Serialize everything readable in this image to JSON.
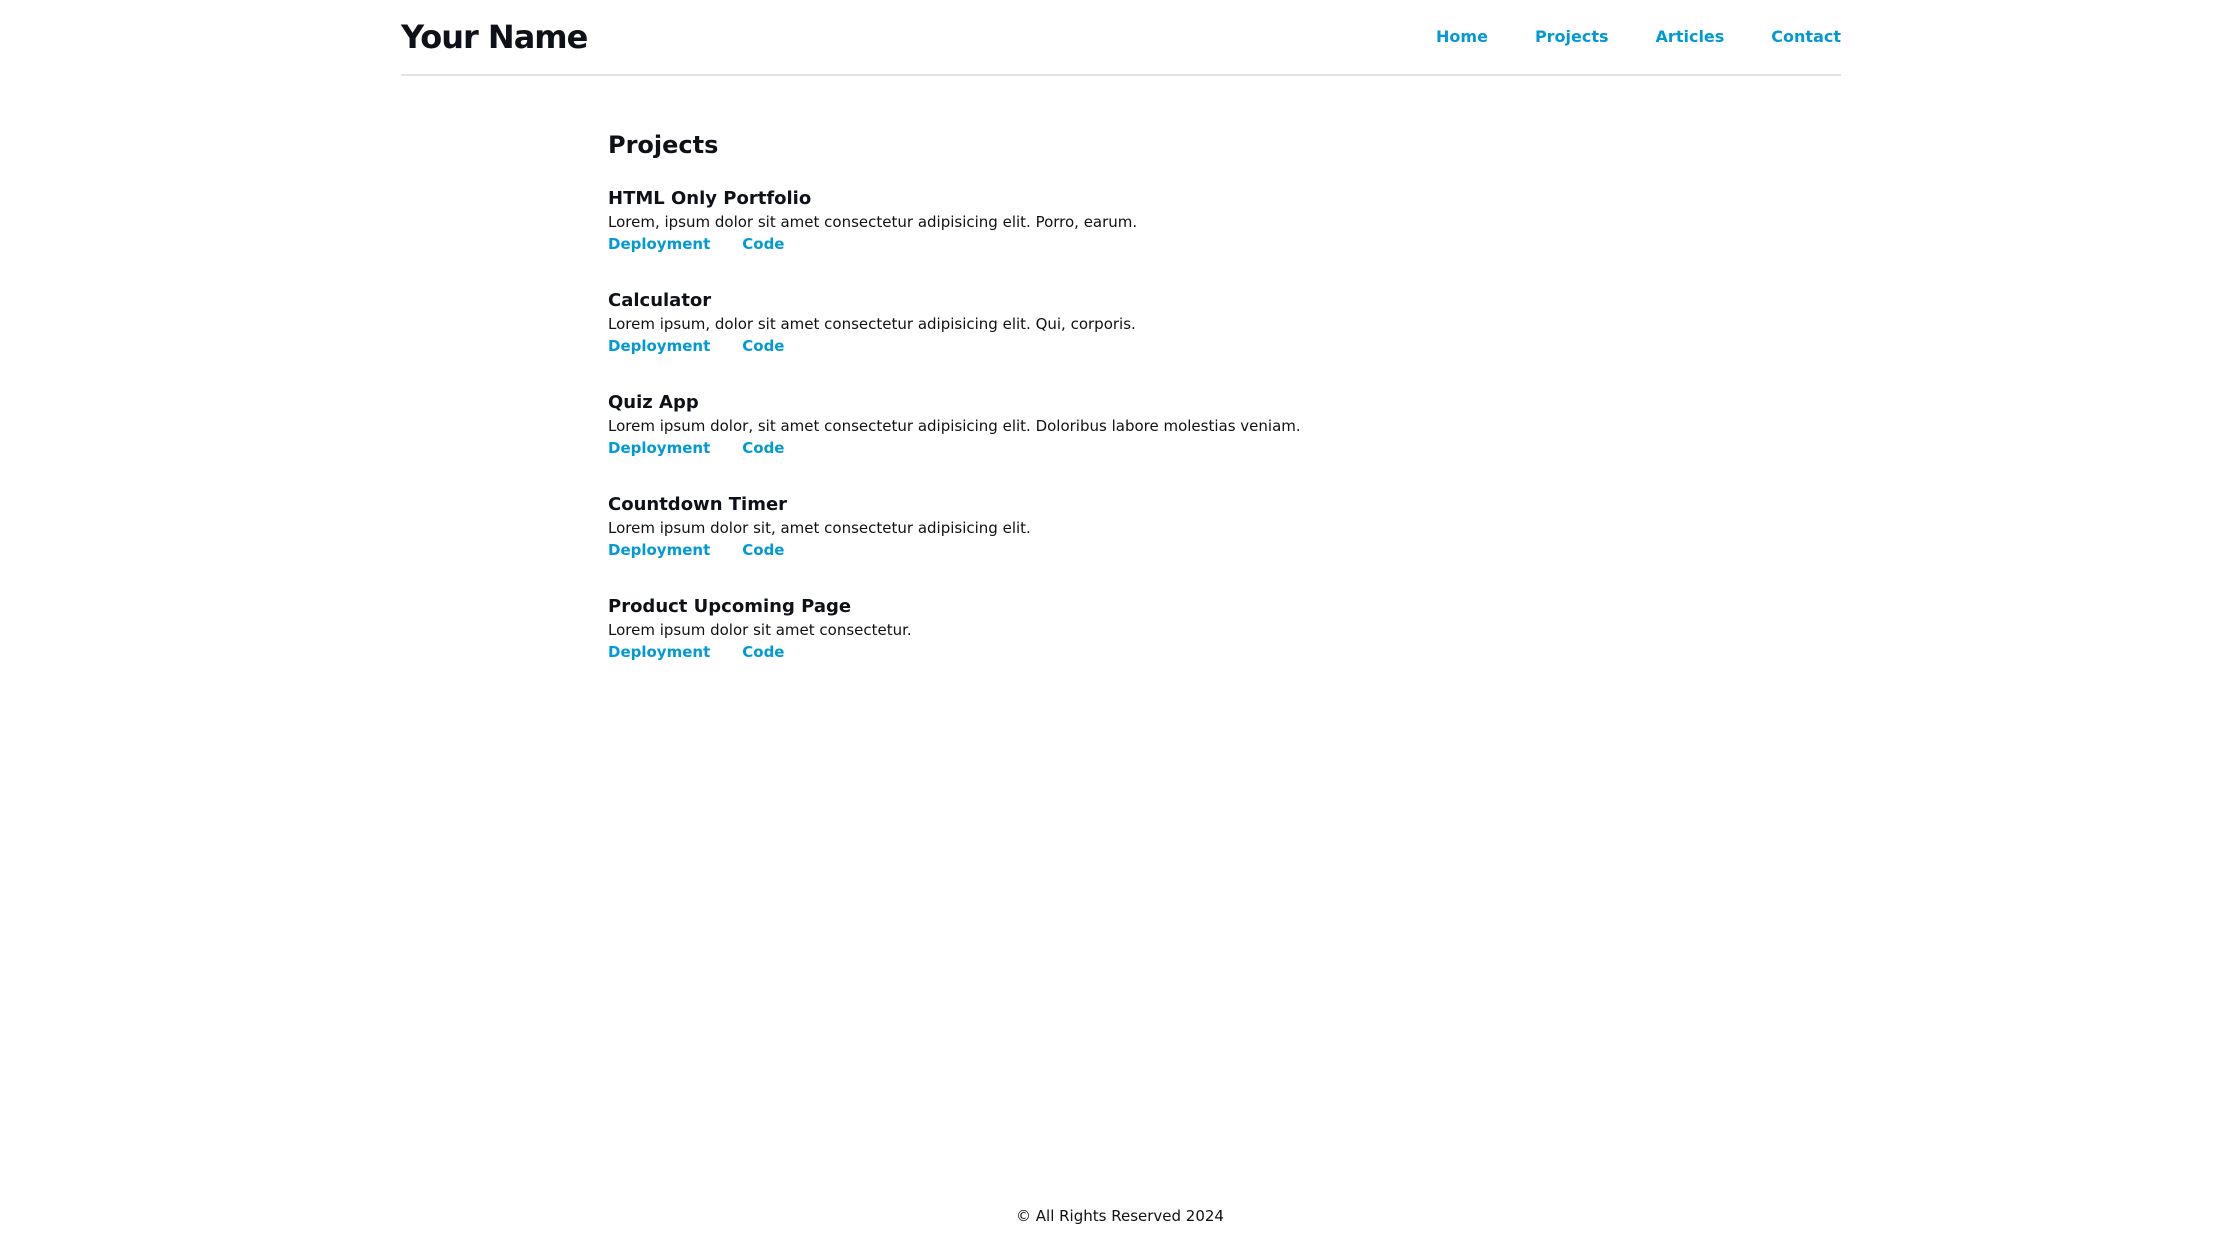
{
  "header": {
    "site_title": "Your Name",
    "nav": [
      {
        "label": "Home"
      },
      {
        "label": "Projects"
      },
      {
        "label": "Articles"
      },
      {
        "label": "Contact"
      }
    ]
  },
  "main": {
    "title": "Projects",
    "projects": [
      {
        "title": "HTML Only Portfolio",
        "description": "Lorem, ipsum dolor sit amet consectetur adipisicing elit. Porro, earum.",
        "links": {
          "deployment": "Deployment",
          "code": "Code"
        }
      },
      {
        "title": "Calculator",
        "description": "Lorem ipsum, dolor sit amet consectetur adipisicing elit. Qui, corporis.",
        "links": {
          "deployment": "Deployment",
          "code": "Code"
        }
      },
      {
        "title": "Quiz App",
        "description": "Lorem ipsum dolor, sit amet consectetur adipisicing elit. Doloribus labore molestias veniam.",
        "links": {
          "deployment": "Deployment",
          "code": "Code"
        }
      },
      {
        "title": "Countdown Timer",
        "description": "Lorem ipsum dolor sit, amet consectetur adipisicing elit.",
        "links": {
          "deployment": "Deployment",
          "code": "Code"
        }
      },
      {
        "title": "Product Upcoming Page",
        "description": "Lorem ipsum dolor sit amet consectetur.",
        "links": {
          "deployment": "Deployment",
          "code": "Code"
        }
      }
    ]
  },
  "footer": {
    "text": "© All Rights Reserved 2024"
  },
  "colors": {
    "link": "#0399d4",
    "heading": "#0f1118",
    "divider": "#e3e3e3"
  }
}
